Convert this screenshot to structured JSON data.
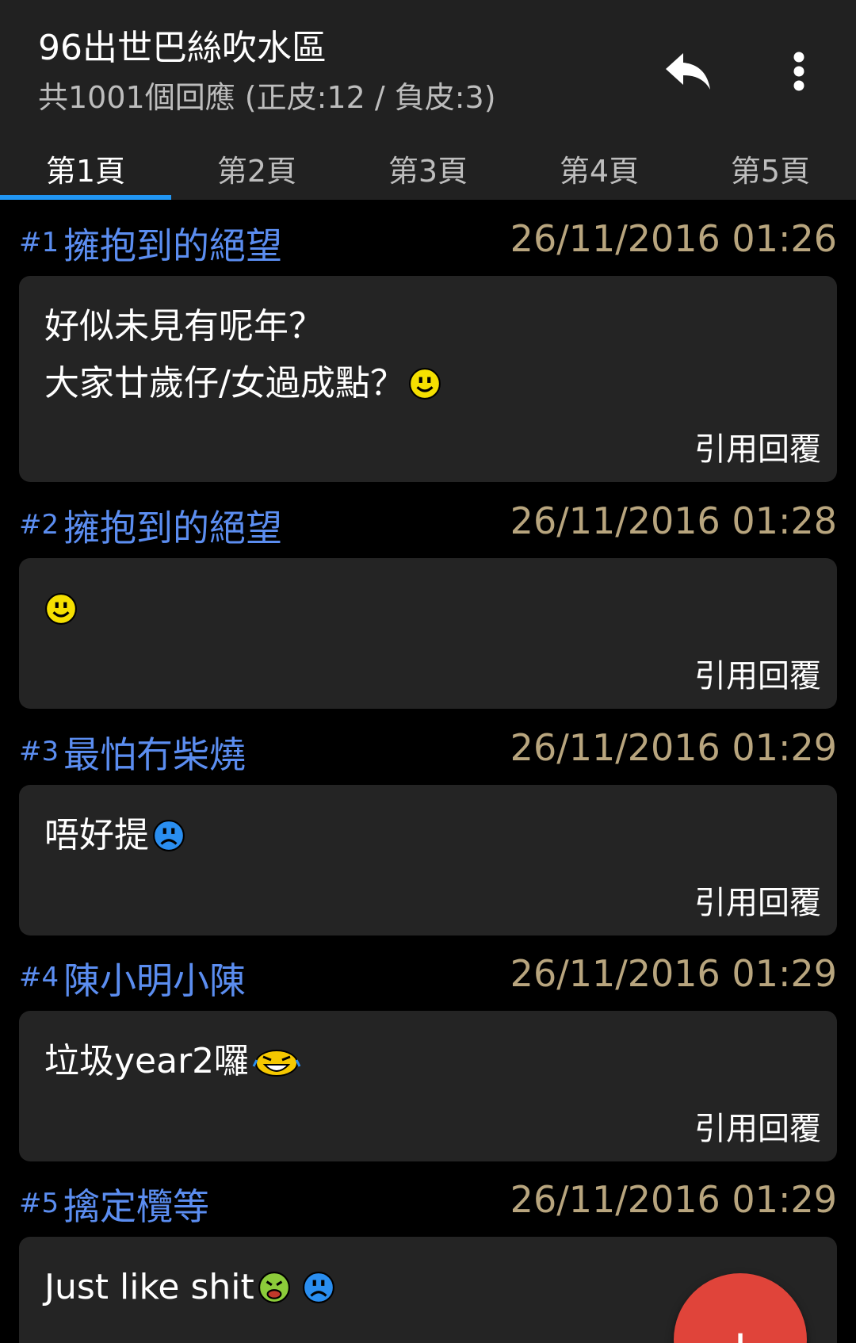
{
  "header": {
    "title": "96出世巴絲吹水區",
    "subtitle": "共1001個回應 (正皮:12 / 負皮:3)",
    "reply_icon": "reply-icon",
    "more_icon": "more-vert-icon"
  },
  "tabs": [
    {
      "label": "第1頁",
      "active": true
    },
    {
      "label": "第2頁",
      "active": false
    },
    {
      "label": "第3頁",
      "active": false
    },
    {
      "label": "第4頁",
      "active": false
    },
    {
      "label": "第5頁",
      "active": false
    }
  ],
  "quote_label": "引用回覆",
  "posts": [
    {
      "num": "#1",
      "author": "擁抱到的絕望",
      "time": "26/11/2016 01:26",
      "lines": [
        "好似未見有呢年？",
        "大家廿歲仔/女過成點？"
      ]
    },
    {
      "num": "#2",
      "author": "擁抱到的絕望",
      "time": "26/11/2016 01:28",
      "lines": [
        ""
      ]
    },
    {
      "num": "#3",
      "author": "最怕冇柴燒",
      "time": "26/11/2016 01:29",
      "lines": [
        "唔好提"
      ]
    },
    {
      "num": "#4",
      "author": "陳小明小陳",
      "time": "26/11/2016 01:29",
      "lines": [
        "垃圾year2囉"
      ]
    },
    {
      "num": "#5",
      "author": "擒定欖等",
      "time": "26/11/2016 01:29",
      "lines": [
        "Just like shit"
      ]
    }
  ],
  "fab": {
    "label": "+"
  },
  "colors": {
    "appbar": "#212121",
    "accent_tab": "#2196f3",
    "author": "#5b8df0",
    "timestamp": "#b8a57e",
    "card": "#242424",
    "fab": "#e0443a"
  }
}
